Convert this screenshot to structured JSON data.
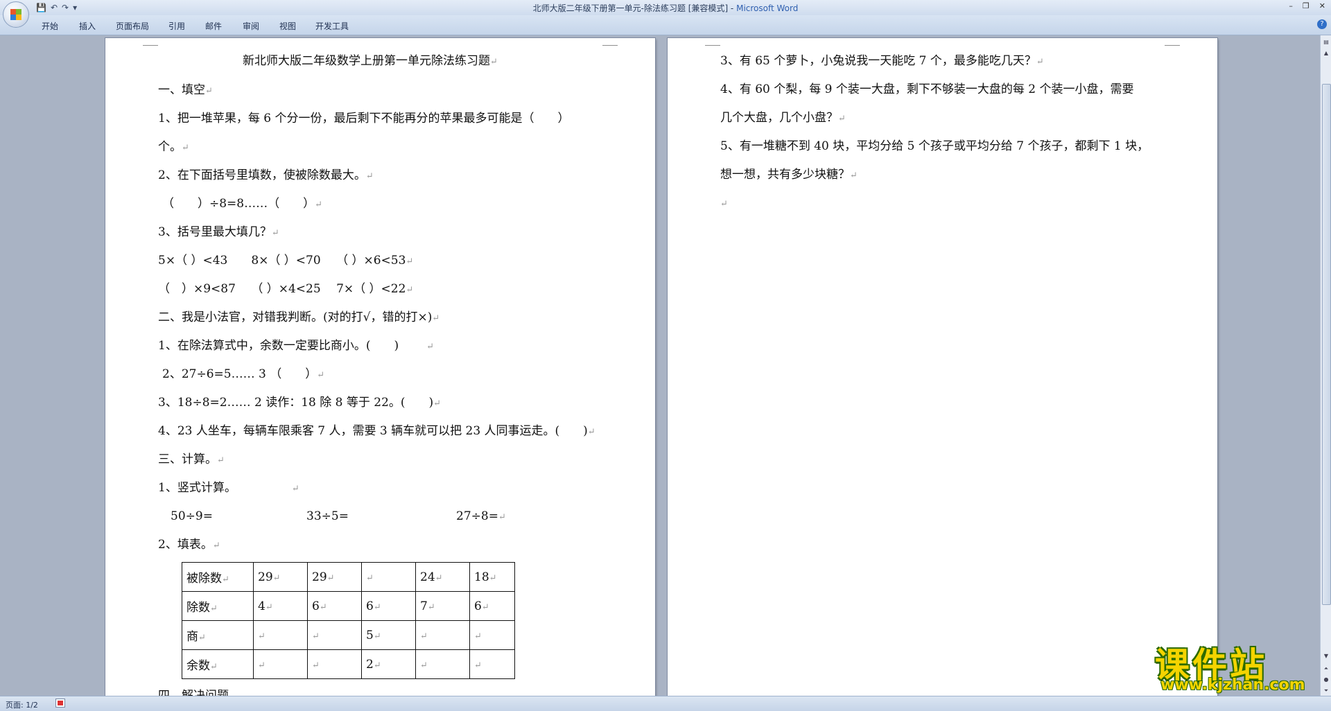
{
  "window": {
    "title": "北师大版二年级下册第一单元-除法练习题 [兼容模式] - ",
    "app_name": "Microsoft Word",
    "minimize": "–",
    "restore": "❐",
    "close": "✕"
  },
  "quick_access": {
    "save": "💾",
    "undo": "↶",
    "redo": "↷",
    "customize": "▾"
  },
  "ribbon_tabs": [
    "开始",
    "插入",
    "页面布局",
    "引用",
    "邮件",
    "审阅",
    "视图",
    "开发工具"
  ],
  "help": "?",
  "para_mark": "↵",
  "left_page": {
    "title": "新北师大版二年级数学上册第一单元除法练习题",
    "lines": [
      "一、填空",
      "1、把一堆苹果，每 6 个分一份，最后剩下不能再分的苹果最多可能是（　　）",
      "个。",
      "2、在下面括号里填数，使被除数最大。",
      "（　　）÷8=8……（　　）",
      "3、括号里最大填几？",
      "5×（  ）<43　　8×（  ）<70　 （  ）×6<53",
      "（　）×9<87　 （  ）×4<25　 7×（  ）<22",
      "二、我是小法官，对错我判断。(对的打√，错的打×)",
      "1、在除法算式中，余数一定要比商小。(　　)",
      "2、27÷6=5…… 3 （　　）",
      "3、18÷8=2…… 2 读作：18 除 8 等于 22。(　　)",
      "4、23 人坐车，每辆车限乘客 7 人，需要 3 辆车就可以把 23 人同事运走。(　　)",
      "三、计算。",
      "1、竖式计算。",
      "2、填表。",
      "四、解决问题。"
    ],
    "calc_items": [
      "50÷9=",
      "33÷5=",
      "27÷8="
    ],
    "table": [
      [
        "被除数",
        "29",
        "29",
        "",
        "24",
        "18"
      ],
      [
        "除数",
        "4",
        "6",
        "6",
        "7",
        "6"
      ],
      [
        "商",
        "",
        "",
        "5",
        "",
        ""
      ],
      [
        "余数",
        "",
        "",
        "2",
        "",
        ""
      ]
    ]
  },
  "right_page": {
    "lines": [
      "3、有 65 个萝卜，小兔说我一天能吃 7 个，最多能吃几天？",
      "4、有 60 个梨，每 9 个装一大盘，剩下不够装一大盘的每 2 个装一小盘，需要",
      "几个大盘，几个小盘？",
      "5、有一堆糖不到 40 块，平均分给 5 个孩子或平均分给 7 个孩子，都剩下 1 块，",
      "想一想，共有多少块糖？",
      ""
    ]
  },
  "status_bar": {
    "page_info": "页面: 1/2"
  },
  "watermark": {
    "brand": "课件站",
    "url": "www.kjzhan.com"
  },
  "colors": {
    "app_blue": "#3060b0",
    "workspace": "#a9b3c4",
    "watermark_yellow": "#f4d400",
    "watermark_green": "#2e6b00"
  }
}
